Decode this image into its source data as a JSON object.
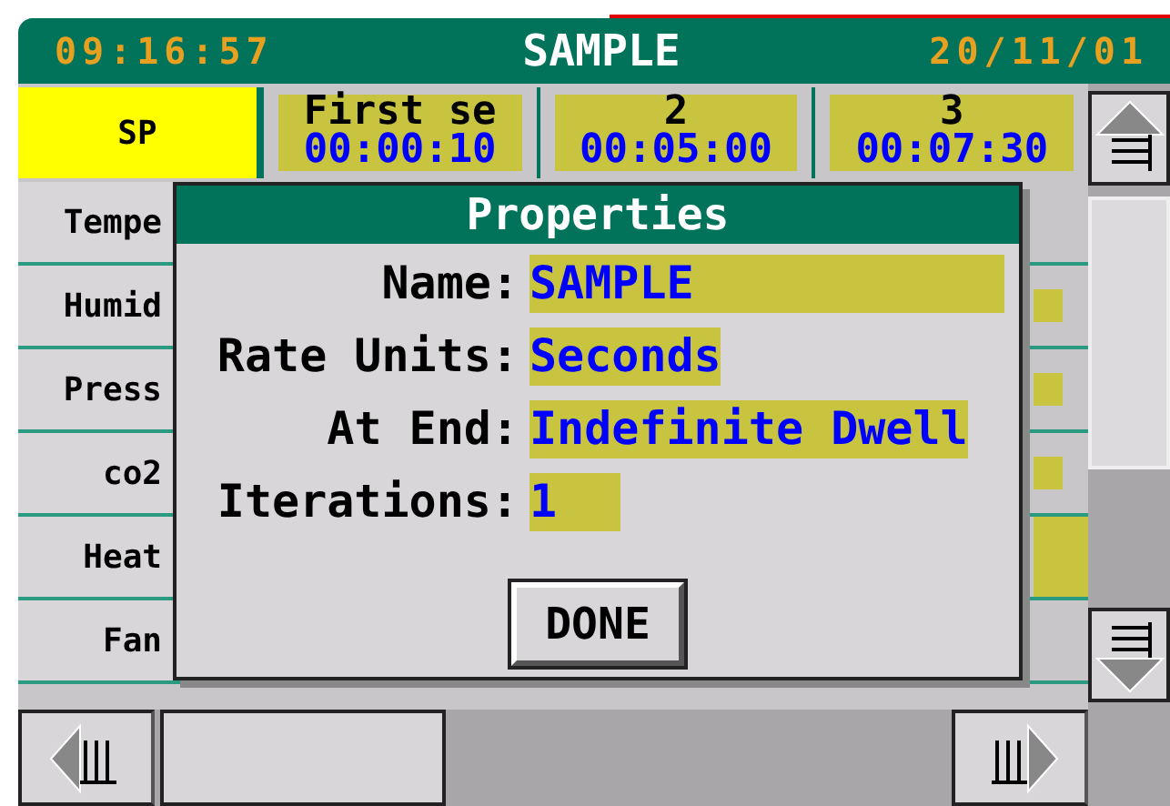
{
  "header": {
    "time": "09:16:57",
    "title": "SAMPLE",
    "date": "20/11/01"
  },
  "corner": {
    "label": "SP",
    "selected": true
  },
  "steps": [
    {
      "name": "First se",
      "duration": "00:00:10"
    },
    {
      "name": "2",
      "duration": "00:05:00"
    },
    {
      "name": "3",
      "duration": "00:07:30"
    }
  ],
  "rows": [
    {
      "label": "Tempe",
      "kind": "blank"
    },
    {
      "label": "Humid",
      "kind": "value"
    },
    {
      "label": "Press",
      "kind": "value"
    },
    {
      "label": "co2",
      "kind": "value"
    },
    {
      "label": "Heat",
      "kind": "output"
    },
    {
      "label": "Fan",
      "kind": "blank"
    }
  ],
  "dialog": {
    "title": "Properties",
    "fields": [
      {
        "label": "Name:",
        "value": "SAMPLE",
        "kind": "text"
      },
      {
        "label": "Rate Units:",
        "value": "Seconds",
        "kind": "choice"
      },
      {
        "label": "At End:",
        "value": "Indefinite Dwell",
        "kind": "choice"
      },
      {
        "label": "Iterations:",
        "value": "1",
        "kind": "number"
      }
    ],
    "button": "DONE"
  }
}
